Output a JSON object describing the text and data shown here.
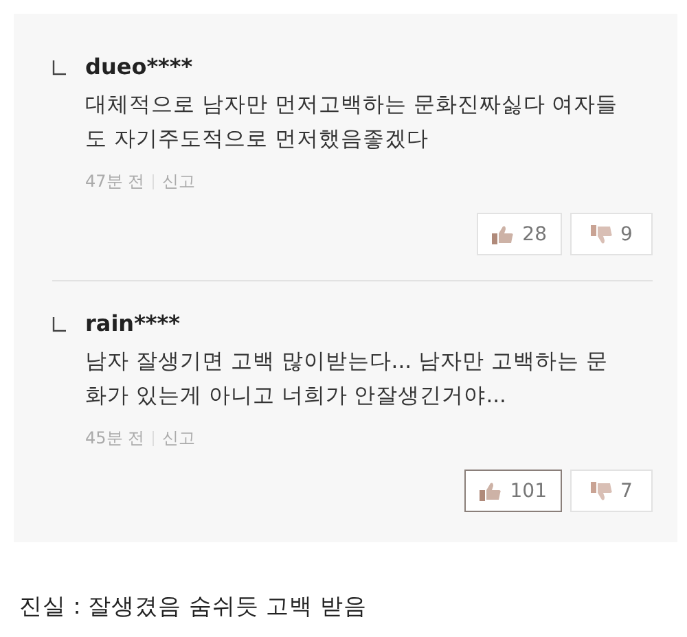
{
  "comments": [
    {
      "username": "dueo****",
      "text": "대체적으로 남자만 먼저고백하는 문화진짜싫다 여자들도 자기주도적으로 먼저했음좋겠다",
      "time": "47분 전",
      "report": "신고",
      "like": {
        "count": "28",
        "selected": false
      },
      "dislike": {
        "count": "9",
        "selected": false
      }
    },
    {
      "username": "rain****",
      "text": "남자 잘생기면 고백 많이받는다... 남자만 고백하는 문화가 있는게 아니고 너희가 안잘생긴거야...",
      "time": "45분 전",
      "report": "신고",
      "like": {
        "count": "101",
        "selected": true
      },
      "dislike": {
        "count": "7",
        "selected": false
      }
    }
  ],
  "caption": "진실 : 잘생겼음 숨쉬듯 고백 받음"
}
